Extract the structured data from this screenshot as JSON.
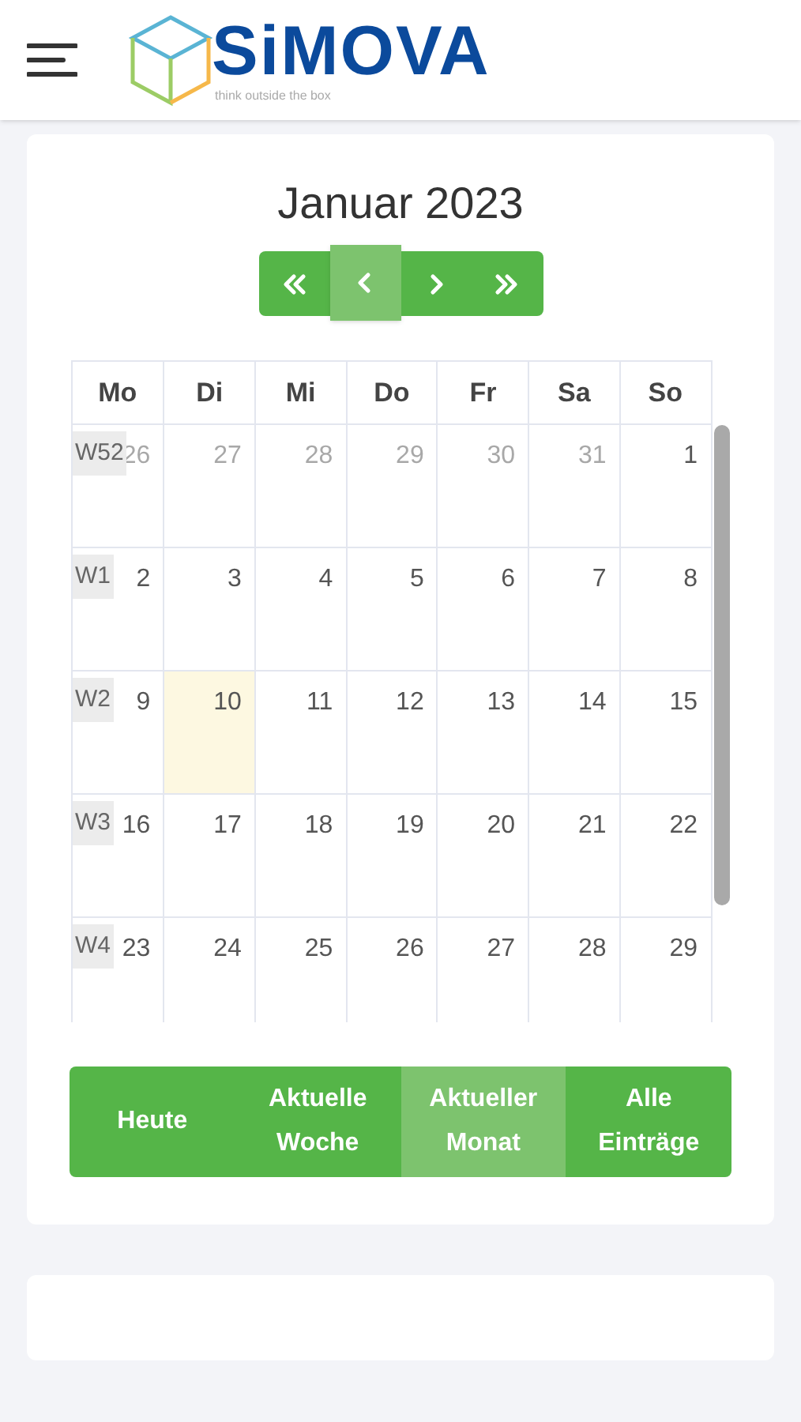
{
  "header": {
    "logo_text": "SiMOVA",
    "tagline": "think outside the box"
  },
  "calendar": {
    "title": "Januar 2023",
    "nav": [
      {
        "kind": "first",
        "selected": false
      },
      {
        "kind": "prev",
        "selected": true
      },
      {
        "kind": "next",
        "selected": false
      },
      {
        "kind": "last",
        "selected": false
      }
    ],
    "weekdays": [
      "Mo",
      "Di",
      "Mi",
      "Do",
      "Fr",
      "Sa",
      "So"
    ],
    "weeks": [
      {
        "label": "W52",
        "days": [
          {
            "text": "26",
            "muted": true,
            "today": false
          },
          {
            "text": "27",
            "muted": true,
            "today": false
          },
          {
            "text": "28",
            "muted": true,
            "today": false
          },
          {
            "text": "29",
            "muted": true,
            "today": false
          },
          {
            "text": "30",
            "muted": true,
            "today": false
          },
          {
            "text": "31",
            "muted": true,
            "today": false
          },
          {
            "text": "1",
            "muted": false,
            "today": false
          }
        ]
      },
      {
        "label": "W1",
        "days": [
          {
            "text": "2",
            "muted": false,
            "today": false
          },
          {
            "text": "3",
            "muted": false,
            "today": false
          },
          {
            "text": "4",
            "muted": false,
            "today": false
          },
          {
            "text": "5",
            "muted": false,
            "today": false
          },
          {
            "text": "6",
            "muted": false,
            "today": false
          },
          {
            "text": "7",
            "muted": false,
            "today": false
          },
          {
            "text": "8",
            "muted": false,
            "today": false
          }
        ]
      },
      {
        "label": "W2",
        "days": [
          {
            "text": "9",
            "muted": false,
            "today": false
          },
          {
            "text": "10",
            "muted": false,
            "today": true
          },
          {
            "text": "11",
            "muted": false,
            "today": false
          },
          {
            "text": "12",
            "muted": false,
            "today": false
          },
          {
            "text": "13",
            "muted": false,
            "today": false
          },
          {
            "text": "14",
            "muted": false,
            "today": false
          },
          {
            "text": "15",
            "muted": false,
            "today": false
          }
        ]
      },
      {
        "label": "W3",
        "days": [
          {
            "text": "16",
            "muted": false,
            "today": false
          },
          {
            "text": "17",
            "muted": false,
            "today": false
          },
          {
            "text": "18",
            "muted": false,
            "today": false
          },
          {
            "text": "19",
            "muted": false,
            "today": false
          },
          {
            "text": "20",
            "muted": false,
            "today": false
          },
          {
            "text": "21",
            "muted": false,
            "today": false
          },
          {
            "text": "22",
            "muted": false,
            "today": false
          }
        ]
      },
      {
        "label": "W4",
        "days": [
          {
            "text": "23",
            "muted": false,
            "today": false
          },
          {
            "text": "24",
            "muted": false,
            "today": false
          },
          {
            "text": "25",
            "muted": false,
            "today": false
          },
          {
            "text": "26",
            "muted": false,
            "today": false
          },
          {
            "text": "27",
            "muted": false,
            "today": false
          },
          {
            "text": "28",
            "muted": false,
            "today": false
          },
          {
            "text": "29",
            "muted": false,
            "today": false
          }
        ]
      }
    ],
    "filters": [
      {
        "label": "Heute",
        "selected": false
      },
      {
        "label": "Aktuelle Woche",
        "selected": false
      },
      {
        "label": "Aktueller Monat",
        "selected": true
      },
      {
        "label": "Alle Einträge",
        "selected": false
      }
    ]
  }
}
